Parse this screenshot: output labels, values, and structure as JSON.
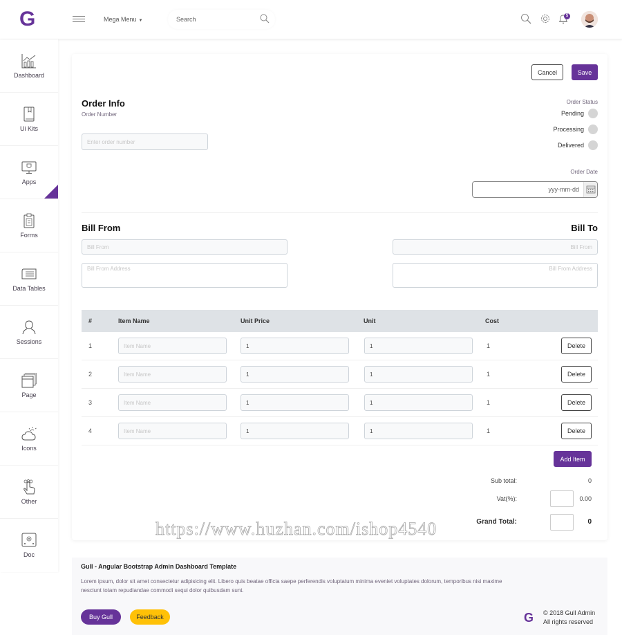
{
  "brand": {
    "logo_letter": "G",
    "accent": "#663399",
    "warning": "#ffc107"
  },
  "header": {
    "mega_menu_label": "Mega Menu",
    "search_placeholder": "Search",
    "notification_count": "5"
  },
  "sidebar": {
    "items": [
      {
        "label": "Dashboard",
        "icon": "dashboard-chart-icon"
      },
      {
        "label": "Ui Kits",
        "icon": "book-icon"
      },
      {
        "label": "Apps",
        "icon": "monitor-icon",
        "active": true
      },
      {
        "label": "Forms",
        "icon": "clipboard-icon"
      },
      {
        "label": "Data Tables",
        "icon": "data-table-icon"
      },
      {
        "label": "Sessions",
        "icon": "user-icon"
      },
      {
        "label": "Page",
        "icon": "pages-icon"
      },
      {
        "label": "Icons",
        "icon": "cloud-sun-icon"
      },
      {
        "label": "Other",
        "icon": "hand-touch-icon"
      },
      {
        "label": "Doc",
        "icon": "safe-icon"
      }
    ]
  },
  "actions": {
    "cancel_label": "Cancel",
    "save_label": "Save"
  },
  "order_info": {
    "title": "Order Info",
    "number_label": "Order Number",
    "number_placeholder": "Enter order number",
    "number_value": "",
    "status_label": "Order Status",
    "statuses": [
      "Pending",
      "Processing",
      "Delivered"
    ],
    "date_label": "Order Date",
    "date_placeholder": "yyy-mm-dd"
  },
  "bill_from": {
    "title": "Bill From",
    "name_placeholder": "Bill From",
    "address_placeholder": "Bill From Address"
  },
  "bill_to": {
    "title": "Bill To",
    "name_placeholder": "Bill From",
    "address_placeholder": "Bill From Address"
  },
  "items_table": {
    "headers": [
      "#",
      "Item Name",
      "Unit Price",
      "Unit",
      "Cost"
    ],
    "item_placeholder": "Item Name",
    "delete_label": "Delete",
    "rows": [
      {
        "num": "1",
        "name": "",
        "unit_price": "1",
        "unit": "1",
        "cost": "1"
      },
      {
        "num": "2",
        "name": "",
        "unit_price": "1",
        "unit": "1",
        "cost": "1"
      },
      {
        "num": "3",
        "name": "",
        "unit_price": "1",
        "unit": "1",
        "cost": "1"
      },
      {
        "num": "4",
        "name": "",
        "unit_price": "1",
        "unit": "1",
        "cost": "1"
      }
    ],
    "add_item_label": "Add Item"
  },
  "totals": {
    "subtotal_label": "Sub total:",
    "subtotal_value": "0",
    "vat_label": "Vat(%):",
    "vat_value": "0.00",
    "grand_total_label": "Grand Total:",
    "grand_total_value": "0"
  },
  "watermark": "https://www.huzhan.com/ishop4540",
  "footer": {
    "title": "Gull - Angular Bootstrap Admin Dashboard Template",
    "text": "Lorem ipsum, dolor sit amet consectetur adipisicing elit. Libero quis beatae officia saepe perferendis voluptatum minima eveniet voluptates dolorum, temporibus nisi maxime nesciunt totam repudiandae commodi sequi dolor quibusdam sunt.",
    "buy_label": "Buy Gull",
    "feedback_label": "Feedback",
    "copyright": "© 2018 Gull Admin",
    "rights": "All rights reserved"
  }
}
